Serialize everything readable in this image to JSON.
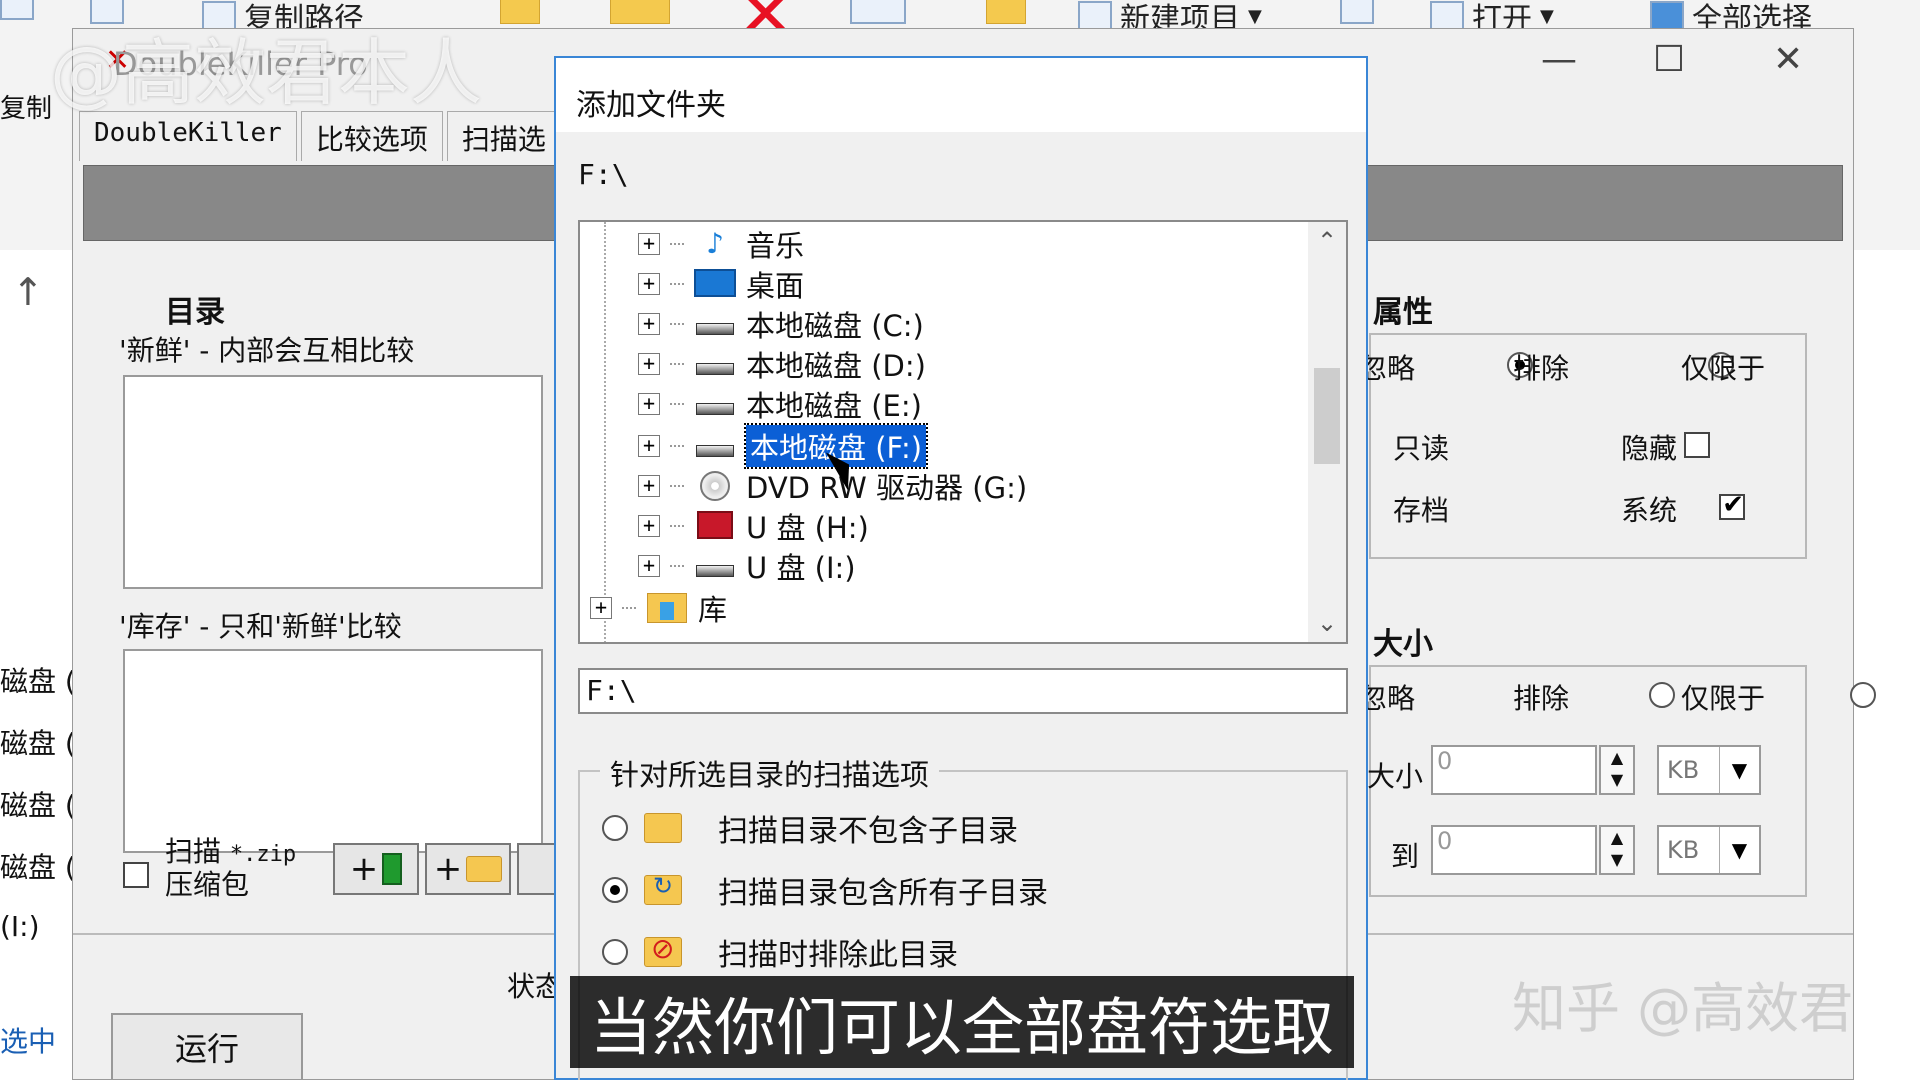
{
  "explorer": {
    "ribbon": {
      "copy_path": "复制路径",
      "new_item": "新建项目",
      "open": "打开",
      "select_all": "全部选择",
      "copy": "复制"
    },
    "sidebar": [
      "磁盘 (",
      "磁盘 (",
      "磁盘 (",
      "磁盘 (",
      "(I:)",
      "选中"
    ]
  },
  "doublekiller": {
    "title": "DoubleKiller Pro",
    "tabs": [
      "DoubleKiller",
      "比较选项",
      "扫描选"
    ],
    "directory": {
      "title": "目录",
      "fresh_caption": "'新鲜' - 内部会互相比较",
      "stock_caption": "'库存' - 只和'新鲜'比较",
      "scan_archive_label_1": "扫描",
      "scan_archive_pattern": "*.zip",
      "scan_archive_label_2": "压缩包"
    },
    "attributes": {
      "title": "属性",
      "ignore": "忽略",
      "exclude": "排除",
      "only": "仅限于",
      "readonly": "只读",
      "hidden": "隐藏",
      "archive": "存档",
      "system": "系统"
    },
    "size": {
      "title": "大小",
      "ignore": "忽略",
      "exclude": "排除",
      "only": "仅限于",
      "from_label": "大小",
      "to_label": "到",
      "from_value": "0",
      "to_value": "0",
      "unit": "KB"
    },
    "status_label": "状态",
    "run_button": "运行"
  },
  "dialog": {
    "title": "添加文件夹",
    "current_path": "F:\\",
    "tree": [
      {
        "label": "音乐",
        "icon": "music-icon"
      },
      {
        "label": "桌面",
        "icon": "desktop-icon"
      },
      {
        "label": "本地磁盘 (C:)",
        "icon": "system-drive-icon"
      },
      {
        "label": "本地磁盘 (D:)",
        "icon": "drive-icon"
      },
      {
        "label": "本地磁盘 (E:)",
        "icon": "drive-icon"
      },
      {
        "label": "本地磁盘 (F:)",
        "icon": "drive-icon",
        "selected": true
      },
      {
        "label": "DVD RW 驱动器 (G:)",
        "icon": "dvd-icon"
      },
      {
        "label": "U 盘 (H:)",
        "icon": "usb-icon"
      },
      {
        "label": "U 盘 (I:)",
        "icon": "drive-icon"
      },
      {
        "label": "库",
        "icon": "library-icon"
      }
    ],
    "path_input_value": "F:\\",
    "scan_options": {
      "legend": "针对所选目录的扫描选项",
      "no_subdirs": "扫描目录不包含子目录",
      "all_subdirs": "扫描目录包含所有子目录",
      "exclude_dir": "扫描时排除此目录",
      "selected": "all_subdirs"
    }
  },
  "overlay": {
    "watermark_top": "@高效君本人",
    "watermark_bottom": "知乎 @高效君",
    "subtitle": "当然你们可以全部盘符选取"
  }
}
